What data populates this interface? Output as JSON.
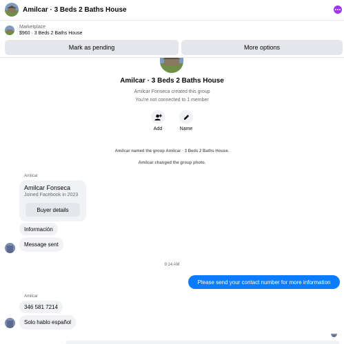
{
  "header": {
    "title": "Amilcar · 3 Beds 2 Baths House"
  },
  "marketplace": {
    "label": "Marketplace",
    "item": "$960 · 3 Beds 2 Baths House",
    "pending_label": "Mark as pending",
    "more_label": "More options"
  },
  "group": {
    "name": "Amilcar · 3 Beds 2 Baths House",
    "created": "Amilcar Fonseca created this group",
    "connected": "You're not connected to 1 member",
    "add_label": "Add",
    "name_label": "Name"
  },
  "events": {
    "named": "Amilcar named the group Amilcar · 3 Beds 2 Baths House.",
    "photo": "Amilcar changed the group photo."
  },
  "thread": {
    "sender1": "Amilcar",
    "card_name": "Amilcar Fonseca",
    "card_joined": "Joined Facebook in 2023",
    "card_button": "Buyer details",
    "msg_info": "Información",
    "msg_sent": "Message sent",
    "time": "9:14 AM",
    "outgoing": "Please send your contact number for more information",
    "sender2": "Amilcar",
    "msg_phone": "346 581 7214",
    "msg_spanish": "Solo hablo español"
  },
  "colors": {
    "accent": "#0a7cff",
    "bubble": "#f0f2f5",
    "button": "#e4e6eb",
    "menu": "#a033ff"
  },
  "icons": {
    "add": "add-person-icon",
    "name": "pencil-icon",
    "menu": "more-dots-icon"
  }
}
